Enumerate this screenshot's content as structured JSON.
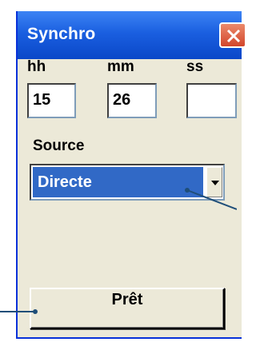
{
  "window": {
    "title": "Synchro",
    "close_icon": "close-icon"
  },
  "time": {
    "hours_label": "hh",
    "minutes_label": "mm",
    "seconds_label": "ss",
    "hours_value": "15",
    "minutes_value": "26",
    "seconds_value": ""
  },
  "source": {
    "label": "Source",
    "selected": "Directe",
    "arrow_icon": "chevron-down-icon"
  },
  "actions": {
    "ready_label": "Prêt"
  },
  "colors": {
    "titlebar": "#1a5fe0",
    "close_button": "#d2462b",
    "selection": "#3169c6",
    "dialog_background": "#ece9d8",
    "callout_line": "#1f4e79"
  }
}
